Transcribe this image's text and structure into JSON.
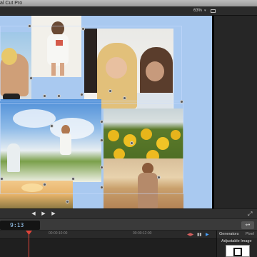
{
  "app": {
    "title": "al Cut Pro"
  },
  "viewer": {
    "zoom": "63%",
    "zoom_caret": "▾"
  },
  "transport": {
    "prev": "◀",
    "play": "▶",
    "next": "▶",
    "fullscreen": "⤢"
  },
  "toolbar": {
    "timecode": "9:13",
    "tool_label": "⌖▾"
  },
  "timeline": {
    "ticks": [
      "00:00:10:00",
      "00:00:12:00"
    ],
    "controls": [
      "◀▶",
      "▮▮",
      "▶"
    ]
  },
  "generators": {
    "header_label": "Generators",
    "header_label_2": "Pixel",
    "item_label": "Adjustable Image"
  },
  "colors": {
    "canvas_bg": "#a9c9f0",
    "playhead": "#e0443a",
    "timecode_text": "#9fd1ff"
  }
}
